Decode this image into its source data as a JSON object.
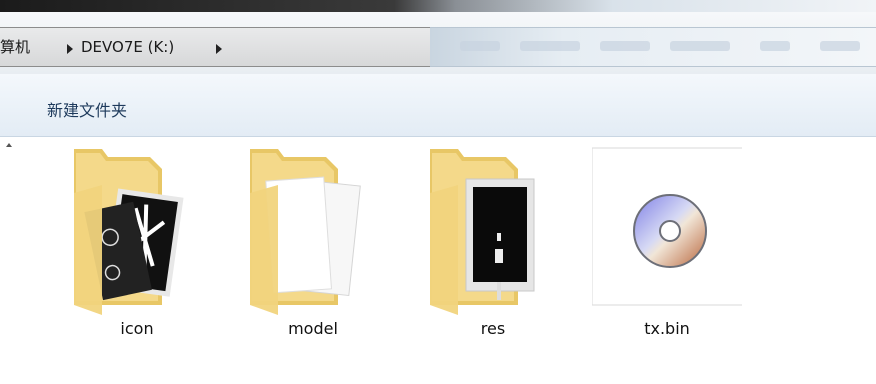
{
  "address": {
    "breadcrumb": [
      "算机",
      "DEVO7E (K:)"
    ]
  },
  "toolbar": {
    "new_folder": "新建文件夹"
  },
  "files": [
    {
      "name": "icon",
      "type": "folder"
    },
    {
      "name": "model",
      "type": "folder"
    },
    {
      "name": "res",
      "type": "folder"
    },
    {
      "name": "tx.bin",
      "type": "file"
    }
  ]
}
